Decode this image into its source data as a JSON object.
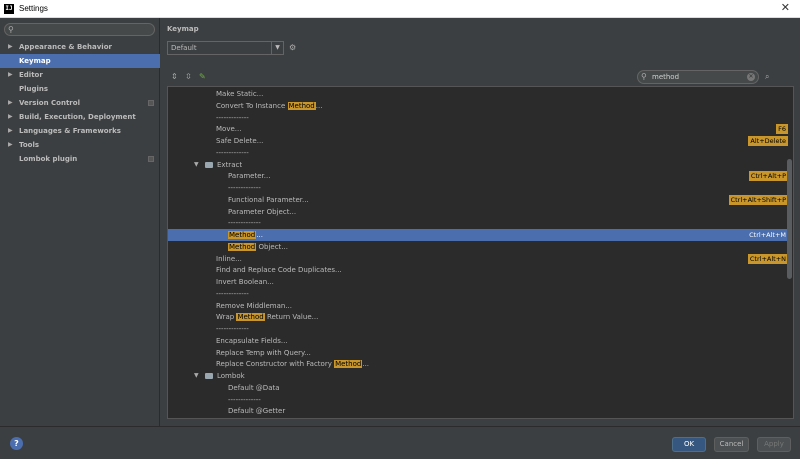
{
  "window": {
    "title": "Settings",
    "app_icon": "IJ"
  },
  "sidebar": {
    "search_placeholder": "",
    "items": [
      {
        "label": "Appearance & Behavior",
        "expandable": true,
        "selected": false,
        "project_marker": false
      },
      {
        "label": "Keymap",
        "expandable": false,
        "selected": true,
        "project_marker": false
      },
      {
        "label": "Editor",
        "expandable": true,
        "selected": false,
        "project_marker": false
      },
      {
        "label": "Plugins",
        "expandable": false,
        "selected": false,
        "project_marker": false
      },
      {
        "label": "Version Control",
        "expandable": true,
        "selected": false,
        "project_marker": true
      },
      {
        "label": "Build, Execution, Deployment",
        "expandable": true,
        "selected": false,
        "project_marker": false
      },
      {
        "label": "Languages & Frameworks",
        "expandable": true,
        "selected": false,
        "project_marker": false
      },
      {
        "label": "Tools",
        "expandable": true,
        "selected": false,
        "project_marker": false
      },
      {
        "label": "Lombok plugin",
        "expandable": false,
        "selected": false,
        "project_marker": true
      }
    ]
  },
  "main": {
    "title": "Keymap",
    "keymap_value": "Default",
    "search_value": "method",
    "highlight_color": "#c8962a",
    "selection_color": "#4b6eaf"
  },
  "tree": [
    {
      "indent": 2,
      "parts": [
        {
          "t": "Make Static..."
        }
      ],
      "shortcut": ""
    },
    {
      "indent": 2,
      "parts": [
        {
          "t": "Convert To Instance "
        },
        {
          "t": "Method",
          "hl": true
        },
        {
          "t": "..."
        }
      ],
      "shortcut": ""
    },
    {
      "indent": 2,
      "parts": [
        {
          "t": "-------------"
        }
      ],
      "shortcut": ""
    },
    {
      "indent": 2,
      "parts": [
        {
          "t": "Move..."
        }
      ],
      "shortcut": "F6"
    },
    {
      "indent": 2,
      "parts": [
        {
          "t": "Safe Delete..."
        }
      ],
      "shortcut": "Alt+Delete"
    },
    {
      "indent": 2,
      "parts": [
        {
          "t": "-------------"
        }
      ],
      "shortcut": ""
    },
    {
      "indent": 1,
      "folder": true,
      "parts": [
        {
          "t": "Extract"
        }
      ],
      "shortcut": ""
    },
    {
      "indent": 3,
      "parts": [
        {
          "t": "Parameter..."
        }
      ],
      "shortcut": "Ctrl+Alt+P"
    },
    {
      "indent": 3,
      "parts": [
        {
          "t": "-------------"
        }
      ],
      "shortcut": ""
    },
    {
      "indent": 3,
      "parts": [
        {
          "t": "Functional Parameter..."
        }
      ],
      "shortcut": "Ctrl+Alt+Shift+P"
    },
    {
      "indent": 3,
      "parts": [
        {
          "t": "Parameter Object..."
        }
      ],
      "shortcut": ""
    },
    {
      "indent": 3,
      "parts": [
        {
          "t": "-------------"
        }
      ],
      "shortcut": ""
    },
    {
      "indent": 3,
      "selected": true,
      "parts": [
        {
          "t": "Method",
          "hl": true
        },
        {
          "t": "..."
        }
      ],
      "shortcut": "Ctrl+Alt+M"
    },
    {
      "indent": 3,
      "parts": [
        {
          "t": "Method",
          "hl": true
        },
        {
          "t": " Object..."
        }
      ],
      "shortcut": ""
    },
    {
      "indent": 2,
      "parts": [
        {
          "t": "Inline..."
        }
      ],
      "shortcut": "Ctrl+Alt+N"
    },
    {
      "indent": 2,
      "parts": [
        {
          "t": "Find and Replace Code Duplicates..."
        }
      ],
      "shortcut": ""
    },
    {
      "indent": 2,
      "parts": [
        {
          "t": "Invert Boolean..."
        }
      ],
      "shortcut": ""
    },
    {
      "indent": 2,
      "parts": [
        {
          "t": "-------------"
        }
      ],
      "shortcut": ""
    },
    {
      "indent": 2,
      "parts": [
        {
          "t": "Remove Middleman..."
        }
      ],
      "shortcut": ""
    },
    {
      "indent": 2,
      "parts": [
        {
          "t": "Wrap "
        },
        {
          "t": "Method",
          "hl": true
        },
        {
          "t": " Return Value..."
        }
      ],
      "shortcut": ""
    },
    {
      "indent": 2,
      "parts": [
        {
          "t": "-------------"
        }
      ],
      "shortcut": ""
    },
    {
      "indent": 2,
      "parts": [
        {
          "t": "Encapsulate Fields..."
        }
      ],
      "shortcut": ""
    },
    {
      "indent": 2,
      "parts": [
        {
          "t": "Replace Temp with Query..."
        }
      ],
      "shortcut": ""
    },
    {
      "indent": 2,
      "parts": [
        {
          "t": "Replace Constructor with Factory "
        },
        {
          "t": "Method",
          "hl": true
        },
        {
          "t": "..."
        }
      ],
      "shortcut": ""
    },
    {
      "indent": 1,
      "folder": true,
      "parts": [
        {
          "t": "Lombok"
        }
      ],
      "shortcut": ""
    },
    {
      "indent": 3,
      "parts": [
        {
          "t": "Default @Data"
        }
      ],
      "shortcut": ""
    },
    {
      "indent": 3,
      "parts": [
        {
          "t": "-------------"
        }
      ],
      "shortcut": ""
    },
    {
      "indent": 3,
      "parts": [
        {
          "t": "Default @Getter"
        }
      ],
      "shortcut": ""
    }
  ],
  "buttons": {
    "help": "?",
    "ok": "OK",
    "cancel": "Cancel",
    "apply": "Apply"
  },
  "icons": {
    "close": "✕",
    "search": "⚲",
    "dropdown": "▼",
    "gear": "⚙",
    "expand_all": "⇕",
    "collapse_all": "⇳",
    "edit": "✎",
    "clear": "✕",
    "find_shortcut": "⌕",
    "collapsed": "▶",
    "expanded": "▼"
  }
}
